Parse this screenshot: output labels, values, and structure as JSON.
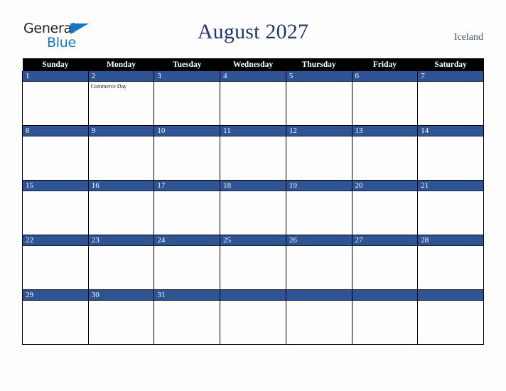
{
  "brand": {
    "name_part1": "General",
    "name_part2": "Blue",
    "triangle_color": "#1279c6",
    "text_color": "#231f20"
  },
  "header": {
    "title": "August 2027",
    "region": "Iceland",
    "title_color": "#20386b",
    "region_color": "#3f5378"
  },
  "calendar": {
    "month": "August",
    "year": "2027",
    "accent_color": "#2e5494",
    "header_bg": "#000000",
    "weekday_headers": [
      "Sunday",
      "Monday",
      "Tuesday",
      "Wednesday",
      "Thursday",
      "Friday",
      "Saturday"
    ],
    "weeks": [
      [
        {
          "day": "1",
          "events": []
        },
        {
          "day": "2",
          "events": [
            "Commerce Day"
          ]
        },
        {
          "day": "3",
          "events": []
        },
        {
          "day": "4",
          "events": []
        },
        {
          "day": "5",
          "events": []
        },
        {
          "day": "6",
          "events": []
        },
        {
          "day": "7",
          "events": []
        }
      ],
      [
        {
          "day": "8",
          "events": []
        },
        {
          "day": "9",
          "events": []
        },
        {
          "day": "10",
          "events": []
        },
        {
          "day": "11",
          "events": []
        },
        {
          "day": "12",
          "events": []
        },
        {
          "day": "13",
          "events": []
        },
        {
          "day": "14",
          "events": []
        }
      ],
      [
        {
          "day": "15",
          "events": []
        },
        {
          "day": "16",
          "events": []
        },
        {
          "day": "17",
          "events": []
        },
        {
          "day": "18",
          "events": []
        },
        {
          "day": "19",
          "events": []
        },
        {
          "day": "20",
          "events": []
        },
        {
          "day": "21",
          "events": []
        }
      ],
      [
        {
          "day": "22",
          "events": []
        },
        {
          "day": "23",
          "events": []
        },
        {
          "day": "24",
          "events": []
        },
        {
          "day": "25",
          "events": []
        },
        {
          "day": "26",
          "events": []
        },
        {
          "day": "27",
          "events": []
        },
        {
          "day": "28",
          "events": []
        }
      ],
      [
        {
          "day": "29",
          "events": []
        },
        {
          "day": "30",
          "events": []
        },
        {
          "day": "31",
          "events": []
        },
        {
          "day": "",
          "events": []
        },
        {
          "day": "",
          "events": []
        },
        {
          "day": "",
          "events": []
        },
        {
          "day": "",
          "events": []
        }
      ]
    ]
  }
}
